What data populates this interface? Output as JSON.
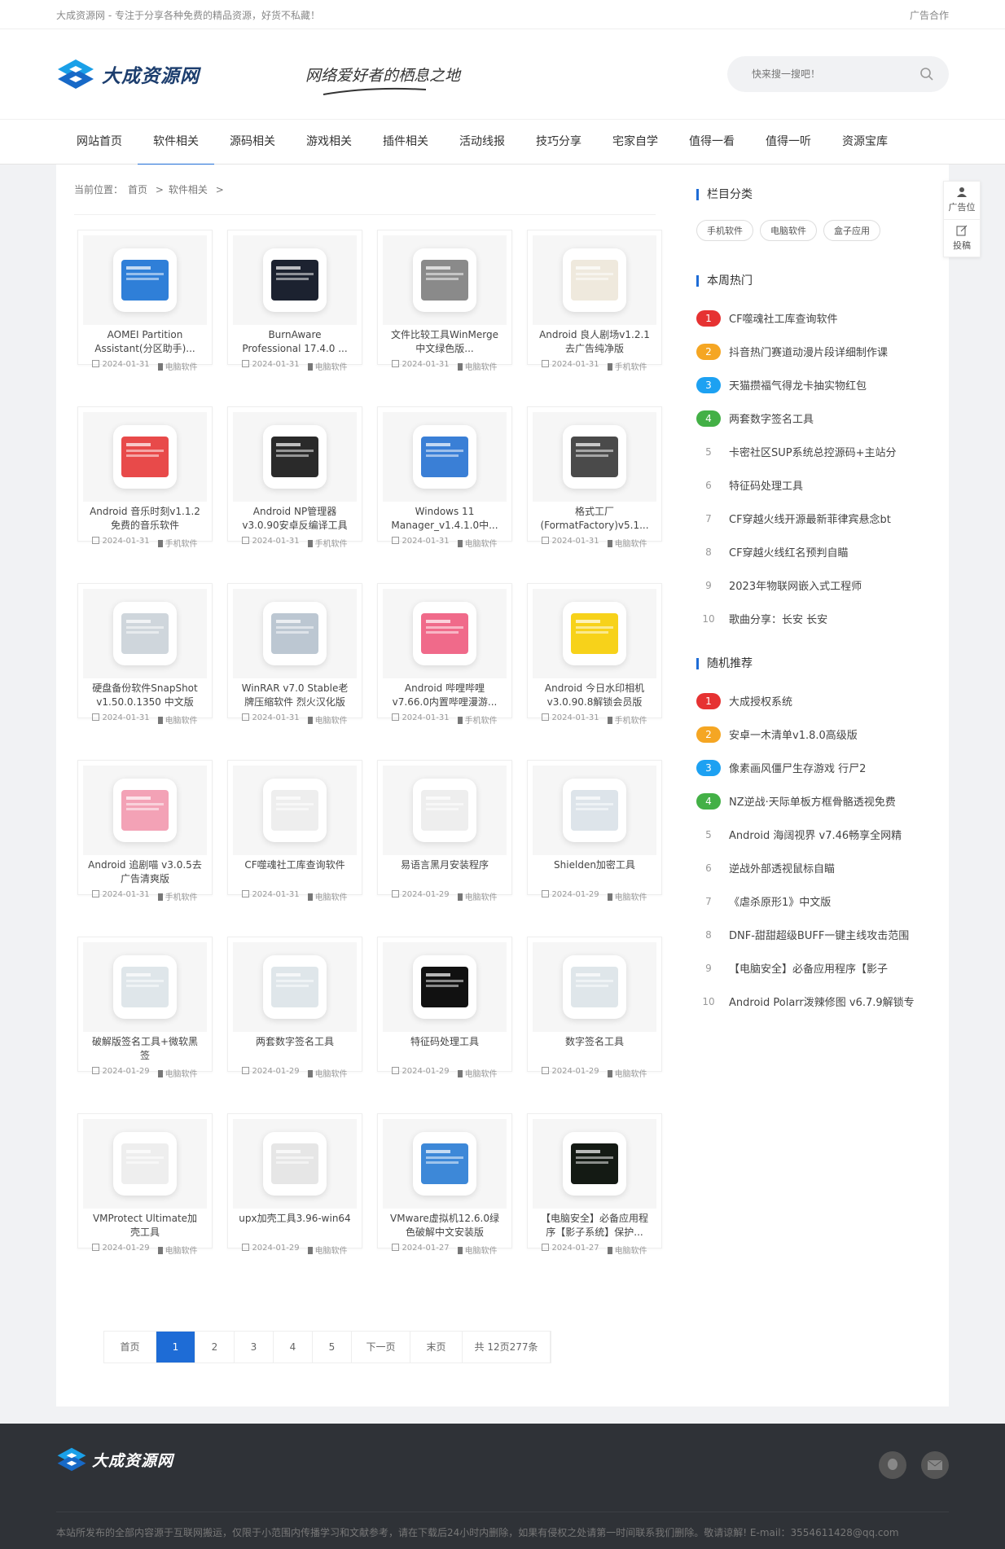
{
  "topbar": {
    "left": "大成资源网 - 专注于分享各种免费的精品资源，好货不私藏！",
    "right": "广告合作"
  },
  "header": {
    "logo_text": "大成资源网",
    "slogan": "网络爱好者的栖息之地",
    "search_placeholder": "快来搜一搜吧！"
  },
  "nav": [
    "网站首页",
    "软件相关",
    "源码相关",
    "游戏相关",
    "插件相关",
    "活动线报",
    "技巧分享",
    "宅家自学",
    "值得一看",
    "值得一听",
    "资源宝库"
  ],
  "crumb": {
    "prefix": "当前位置：",
    "home": "首页",
    "sep": ">",
    "cat": "软件相关"
  },
  "cards": [
    {
      "title": "AOMEI Partition Assistant(分区助手)...",
      "date": "2024-01-31",
      "cat": "电脑软件"
    },
    {
      "title": "BurnAware Professional 17.4.0 ...",
      "date": "2024-01-31",
      "cat": "电脑软件"
    },
    {
      "title": "文件比较工具WinMerge中文绿色版...",
      "date": "2024-01-31",
      "cat": "电脑软件"
    },
    {
      "title": "Android 良人剧场v1.2.1去广告纯净版",
      "date": "2024-01-31",
      "cat": "手机软件"
    },
    {
      "title": "Android 音乐时刻v1.1.2免费的音乐软件",
      "date": "2024-01-31",
      "cat": "手机软件"
    },
    {
      "title": "Android NP管理器v3.0.90安卓反编译工具",
      "date": "2024-01-31",
      "cat": "手机软件"
    },
    {
      "title": "Windows 11 Manager_v1.4.1.0中...",
      "date": "2024-01-31",
      "cat": "电脑软件"
    },
    {
      "title": "格式工厂(FormatFactory)v5.1...",
      "date": "2024-01-31",
      "cat": "电脑软件"
    },
    {
      "title": "硬盘备份软件SnapShot v1.50.0.1350 中文版",
      "date": "2024-01-31",
      "cat": "电脑软件"
    },
    {
      "title": "WinRAR v7.0 Stable老牌压缩软件 烈火汉化版",
      "date": "2024-01-31",
      "cat": "电脑软件"
    },
    {
      "title": "Android 哔哩哔哩v7.66.0内置哔哩漫游...",
      "date": "2024-01-31",
      "cat": "手机软件"
    },
    {
      "title": "Android 今日水印相机v3.0.90.8解锁会员版",
      "date": "2024-01-31",
      "cat": "手机软件"
    },
    {
      "title": "Android 追剧喵 v3.0.5去广告清爽版",
      "date": "2024-01-31",
      "cat": "手机软件"
    },
    {
      "title": "CF噬魂社工库查询软件",
      "date": "2024-01-31",
      "cat": "电脑软件"
    },
    {
      "title": "易语言黑月安装程序",
      "date": "2024-01-29",
      "cat": "电脑软件"
    },
    {
      "title": "Shielden加密工具",
      "date": "2024-01-29",
      "cat": "电脑软件"
    },
    {
      "title": "破解版签名工具+微软黑签",
      "date": "2024-01-29",
      "cat": "电脑软件"
    },
    {
      "title": "两套数字签名工具",
      "date": "2024-01-29",
      "cat": "电脑软件"
    },
    {
      "title": "特征码处理工具",
      "date": "2024-01-29",
      "cat": "电脑软件"
    },
    {
      "title": "数字签名工具",
      "date": "2024-01-29",
      "cat": "电脑软件"
    },
    {
      "title": "VMProtect Ultimate加壳工具",
      "date": "2024-01-29",
      "cat": "电脑软件"
    },
    {
      "title": "upx加壳工具3.96-win64",
      "date": "2024-01-29",
      "cat": "电脑软件"
    },
    {
      "title": "VMware虚拟机12.6.0绿色破解中文安装版",
      "date": "2024-01-27",
      "cat": "电脑软件"
    },
    {
      "title": "【电脑安全】必备应用程序【影子系统】保护...",
      "date": "2024-01-27",
      "cat": "电脑软件"
    }
  ],
  "pager": [
    "首页",
    "1",
    "2",
    "3",
    "4",
    "5",
    "下一页",
    "末页",
    "共 12页277条"
  ],
  "side": {
    "cat_title": "栏目分类",
    "cat_tags": [
      "手机软件",
      "电脑软件",
      "盒子应用"
    ],
    "hot_title": "本周热门",
    "hot": [
      "CF噬魂社工库查询软件",
      "抖音热门赛道动漫片段详细制作课",
      "天猫攒福气得龙卡抽实物红包",
      "两套数字签名工具",
      "卡密社区SUP系统总控源码+主站分",
      "特征码处理工具",
      "CF穿越火线开源最新菲律宾悬念bt",
      "CF穿越火线红名预判自瞄",
      "2023年物联网嵌入式工程师",
      "歌曲分享：长安 长安"
    ],
    "rand_title": "随机推荐",
    "rand": [
      "大成授权系统",
      "安卓一木清单v1.8.0高级版",
      "像素画风僵尸生存游戏 行尸2",
      "NZ逆战·天际单板方框骨骼透视免费",
      "Android 海阔视界 v7.46畅享全网精",
      "逆战外部透视鼠标自瞄",
      "《虐杀原形1》中文版",
      "DNF-甜甜超级BUFF一键主线攻击范围",
      "【电脑安全】必备应用程序【影子",
      "Android Polarr泼辣修图 v6.7.9解锁专"
    ]
  },
  "float": {
    "ad": "广告位",
    "post": "投稿"
  },
  "footer": {
    "logo_text": "大成资源网",
    "notice": "本站所发布的全部内容源于互联网搬运，仅限于小范围内传播学习和文献参考，请在下载后24小时内删除，如果有侵权之处请第一时间联系我们删除。敬请谅解! E-mail：3554611428@qq.com"
  }
}
